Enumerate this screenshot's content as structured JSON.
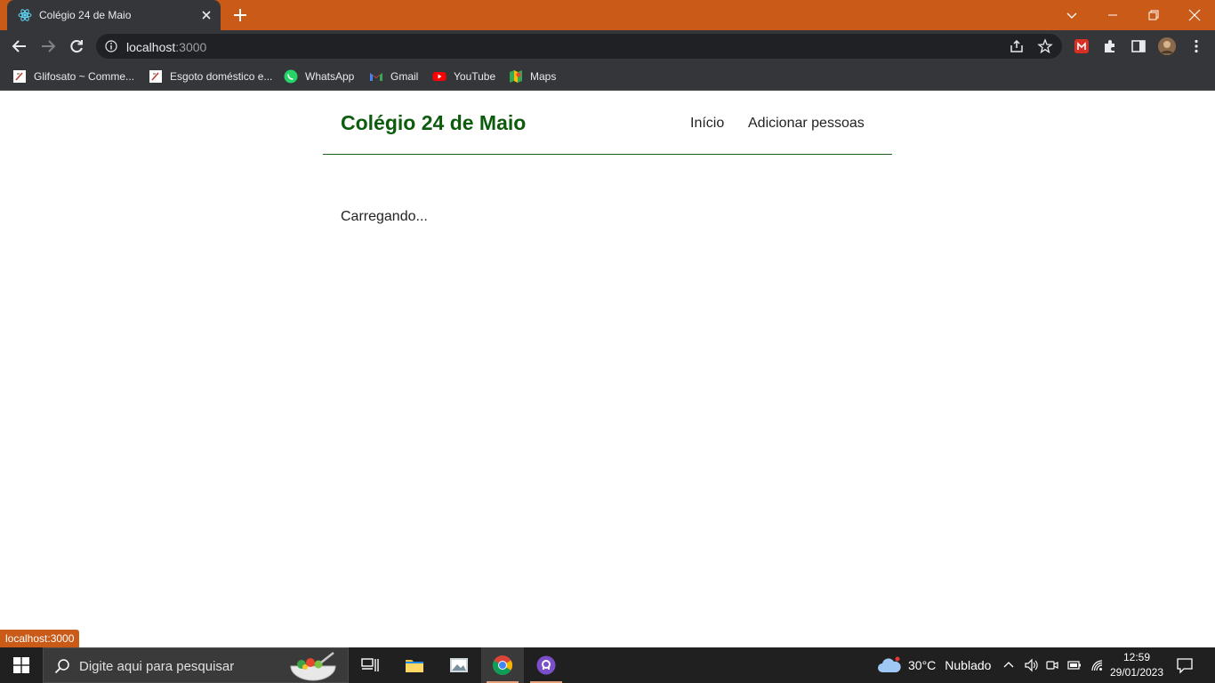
{
  "browser": {
    "tab_title": "Colégio 24 de Maio",
    "url_host": "localhost",
    "url_port": ":3000",
    "bookmarks": [
      {
        "label": "Glifosato ~ Comme...",
        "icon": "document-icon"
      },
      {
        "label": "Esgoto doméstico e...",
        "icon": "document-icon"
      },
      {
        "label": "WhatsApp",
        "icon": "whatsapp-icon"
      },
      {
        "label": "Gmail",
        "icon": "gmail-icon"
      },
      {
        "label": "YouTube",
        "icon": "youtube-icon"
      },
      {
        "label": "Maps",
        "icon": "maps-icon"
      }
    ],
    "status_url": "localhost:3000",
    "chrome_color": "#c95a17"
  },
  "page": {
    "brand": "Colégio 24 de Maio",
    "nav": {
      "home": "Início",
      "add_people": "Adicionar pessoas"
    },
    "loading_text": "Carregando...",
    "brand_color": "#0d5c0d"
  },
  "taskbar": {
    "search_placeholder": "Digite aqui para pesquisar",
    "weather": {
      "temp": "30°C",
      "condition": "Nublado"
    },
    "time": "12:59",
    "date": "29/01/2023"
  }
}
